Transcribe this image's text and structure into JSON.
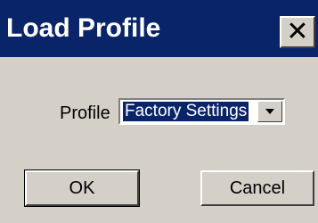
{
  "window": {
    "title": "Load Profile",
    "close_symbol": "✕"
  },
  "form": {
    "profile_label": "Profile",
    "profile_value": "Factory Settings"
  },
  "buttons": {
    "ok_label": "OK",
    "cancel_label": "Cancel"
  },
  "colors": {
    "titlebar": "#0a246a",
    "face": "#d4d0c8",
    "selection": "#0a246a"
  },
  "icons": {
    "close": "close-icon",
    "dropdown": "chevron-down-icon"
  }
}
